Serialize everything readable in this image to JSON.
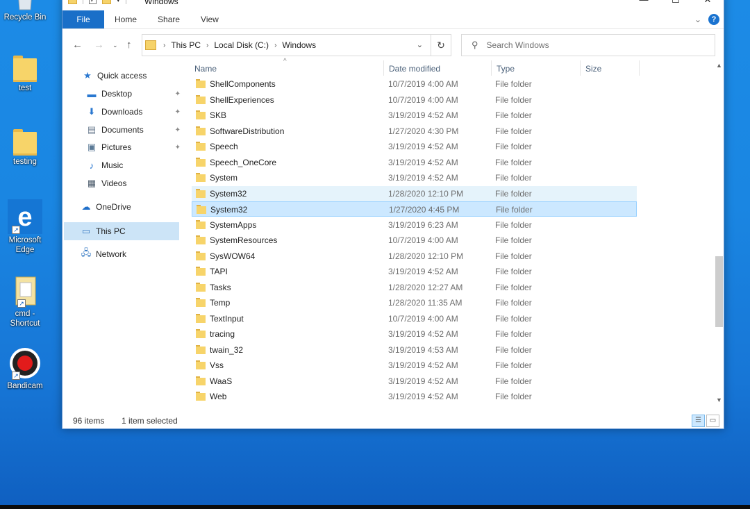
{
  "desktop": {
    "icons": [
      {
        "label": "Recycle Bin"
      },
      {
        "label": "test"
      },
      {
        "label": "testing"
      },
      {
        "label": "Microsoft Edge"
      },
      {
        "label": "cmd - Shortcut"
      },
      {
        "label": "Bandicam"
      }
    ]
  },
  "window": {
    "title": "Windows",
    "controls": {
      "minimize": "—",
      "maximize": "☐",
      "close": "✕"
    },
    "ribbon_tabs": [
      "File",
      "Home",
      "Share",
      "View"
    ],
    "address": {
      "crumbs": [
        "This PC",
        "Local Disk (C:)",
        "Windows"
      ]
    },
    "search": {
      "placeholder": "Search Windows"
    },
    "nav": {
      "quick_access": "Quick access",
      "items": [
        "Desktop",
        "Downloads",
        "Documents",
        "Pictures",
        "Music",
        "Videos"
      ],
      "onedrive": "OneDrive",
      "this_pc": "This PC",
      "network": "Network"
    },
    "columns": [
      "Name",
      "Date modified",
      "Type",
      "Size"
    ],
    "files": [
      {
        "name": "ShellComponents",
        "date": "10/7/2019 4:00 AM",
        "type": "File folder"
      },
      {
        "name": "ShellExperiences",
        "date": "10/7/2019 4:00 AM",
        "type": "File folder"
      },
      {
        "name": "SKB",
        "date": "3/19/2019 4:52 AM",
        "type": "File folder"
      },
      {
        "name": "SoftwareDistribution",
        "date": "1/27/2020 4:30 PM",
        "type": "File folder"
      },
      {
        "name": "Speech",
        "date": "3/19/2019 4:52 AM",
        "type": "File folder"
      },
      {
        "name": "Speech_OneCore",
        "date": "3/19/2019 4:52 AM",
        "type": "File folder"
      },
      {
        "name": "System",
        "date": "3/19/2019 4:52 AM",
        "type": "File folder"
      },
      {
        "name": "System32",
        "date": "1/28/2020 12:10 PM",
        "type": "File folder"
      },
      {
        "name": "System32",
        "date": "1/27/2020 4:45 PM",
        "type": "File folder"
      },
      {
        "name": "SystemApps",
        "date": "3/19/2019 6:23 AM",
        "type": "File folder"
      },
      {
        "name": "SystemResources",
        "date": "10/7/2019 4:00 AM",
        "type": "File folder"
      },
      {
        "name": "SysWOW64",
        "date": "1/28/2020 12:10 PM",
        "type": "File folder"
      },
      {
        "name": "TAPI",
        "date": "3/19/2019 4:52 AM",
        "type": "File folder"
      },
      {
        "name": "Tasks",
        "date": "1/28/2020 12:27 AM",
        "type": "File folder"
      },
      {
        "name": "Temp",
        "date": "1/28/2020 11:35 AM",
        "type": "File folder"
      },
      {
        "name": "TextInput",
        "date": "10/7/2019 4:00 AM",
        "type": "File folder"
      },
      {
        "name": "tracing",
        "date": "3/19/2019 4:52 AM",
        "type": "File folder"
      },
      {
        "name": "twain_32",
        "date": "3/19/2019 4:53 AM",
        "type": "File folder"
      },
      {
        "name": "Vss",
        "date": "3/19/2019 4:52 AM",
        "type": "File folder"
      },
      {
        "name": "WaaS",
        "date": "3/19/2019 4:52 AM",
        "type": "File folder"
      },
      {
        "name": "Web",
        "date": "3/19/2019 4:52 AM",
        "type": "File folder"
      }
    ],
    "hover_row": "System32",
    "selected_row": "System32",
    "status": {
      "items": "96 items",
      "selection": "1 item selected"
    }
  },
  "colors": {
    "accent": "#1a6fc8",
    "selection": "#cce8ff",
    "desktop": "#1a86e2"
  }
}
